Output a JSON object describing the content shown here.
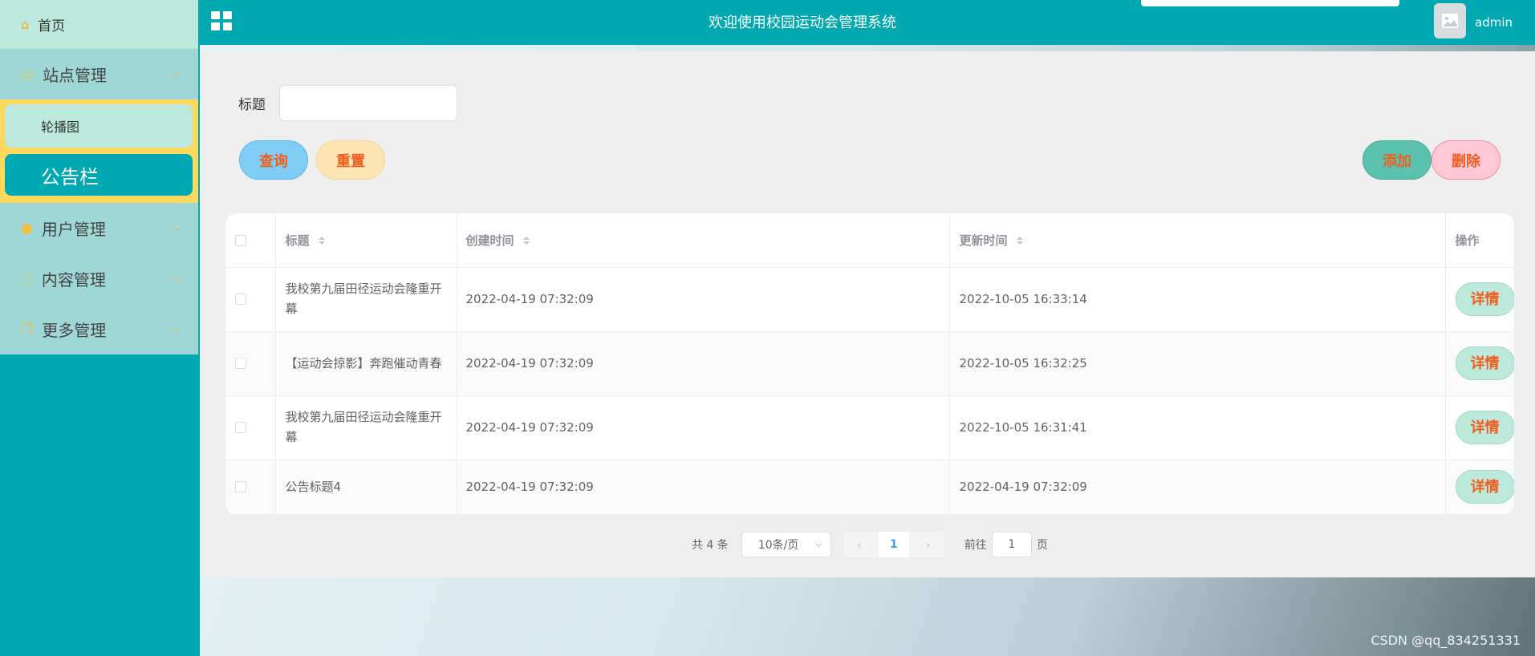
{
  "sidebar": {
    "home": "首页",
    "groups": [
      {
        "label": "站点管理",
        "icon": "monitor-icon"
      },
      {
        "label": "用户管理",
        "icon": "user-icon"
      },
      {
        "label": "内容管理",
        "icon": "chat-icon"
      },
      {
        "label": "更多管理",
        "icon": "copy-icon"
      }
    ],
    "subitems": [
      {
        "label": "轮播图"
      },
      {
        "label": "公告栏"
      }
    ]
  },
  "header": {
    "title": "欢迎使用校园运动会管理系统",
    "username": "admin"
  },
  "search": {
    "label": "标题",
    "placeholder": "",
    "value": ""
  },
  "buttons": {
    "query": "查询",
    "reset": "重置",
    "add": "添加",
    "delete": "删除",
    "detail": "详情"
  },
  "table": {
    "columns": [
      "标题",
      "创建时间",
      "更新时间",
      "操作"
    ],
    "rows": [
      {
        "title": "我校第九届田径运动会隆重开幕",
        "created": "2022-04-19 07:32:09",
        "updated": "2022-10-05 16:33:14"
      },
      {
        "title": "【运动会掠影】奔跑催动青春",
        "created": "2022-04-19 07:32:09",
        "updated": "2022-10-05 16:32:25"
      },
      {
        "title": "我校第九届田径运动会隆重开幕",
        "created": "2022-04-19 07:32:09",
        "updated": "2022-10-05 16:31:41"
      },
      {
        "title": "公告标题4",
        "created": "2022-04-19 07:32:09",
        "updated": "2022-04-19 07:32:09"
      }
    ]
  },
  "pagination": {
    "total": "共 4 条",
    "page_size": "10条/页",
    "current_page": "1",
    "goto_label": "前往",
    "goto_value": "1",
    "page_suffix": "页"
  },
  "watermark": "CSDN @qq_834251331",
  "colors": {
    "primary": "#00a9b2",
    "accent_text": "#f25c1d",
    "highlight": "#ffd85e"
  }
}
